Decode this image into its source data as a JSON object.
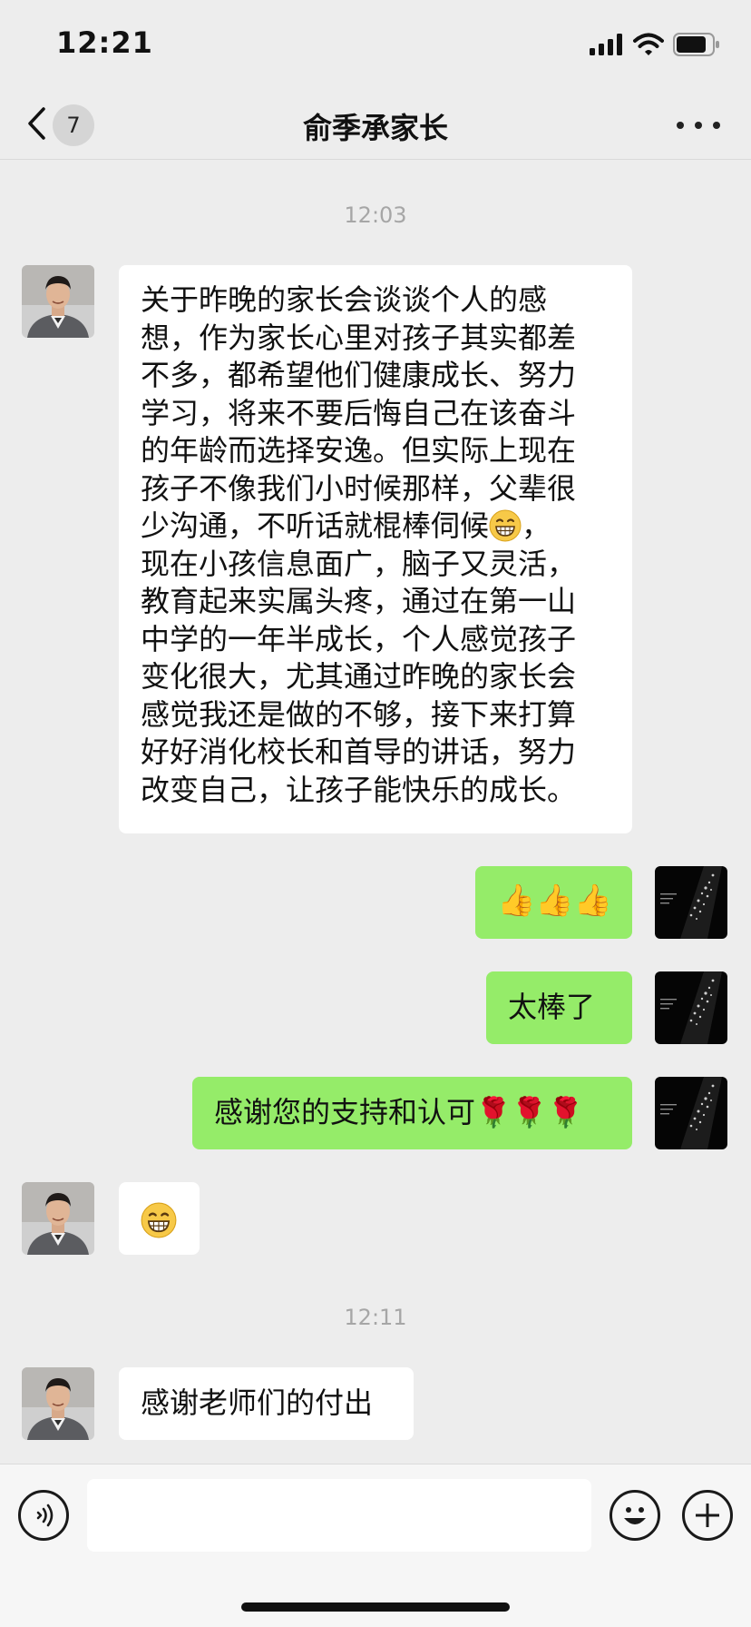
{
  "status_bar": {
    "time": "12:21",
    "icons": [
      "signal-icon",
      "wifi-icon",
      "battery-icon"
    ]
  },
  "nav": {
    "back_count": "7",
    "title": "俞季承家长",
    "icons": [
      "chevron-left-icon",
      "more-icon"
    ]
  },
  "messages": [
    {
      "type": "time",
      "text": "12:03"
    },
    {
      "type": "message",
      "side": "left",
      "sender": "parent",
      "lines": [
        "关于昨晚的家长会谈谈个人的感",
        "想，作为家长心里对孩子其实都差",
        "不多，都希望他们健康成长、努力",
        "学习，将来不要后悔自己在该奋斗",
        "的年龄而选择安逸。但实际上现在",
        "孩子不像我们小时候那样，父辈很",
        "少沟通，不听话就棍棒伺候",
        "，",
        "现在小孩信息面广，脑子又灵活，",
        "教育起来实属头疼，通过在第一山",
        "中学的一年半成长，个人感觉孩子",
        "变化很大，尤其通过昨晚的家长会",
        "感觉我还是做的不够，接下来打算",
        "好好消化校长和首导的讲话，努力",
        "改变自己，让孩子能快乐的成长。"
      ]
    },
    {
      "type": "message",
      "side": "right",
      "sender": "self",
      "text": "👍👍👍"
    },
    {
      "type": "message",
      "side": "right",
      "sender": "self",
      "text": "太棒了"
    },
    {
      "type": "message",
      "side": "right",
      "sender": "self",
      "text": "感谢您的支持和认可🌹🌹🌹"
    },
    {
      "type": "message",
      "side": "left",
      "sender": "parent",
      "emoji": "grinning-face-icon"
    },
    {
      "type": "time",
      "text": "12:11"
    },
    {
      "type": "message",
      "side": "left",
      "sender": "parent",
      "text": "感谢老师们的付出"
    }
  ],
  "input_bar": {
    "icons": [
      "voice-icon",
      "emoji-icon",
      "plus-icon"
    ],
    "input_value": ""
  },
  "colors": {
    "background": "#ededed",
    "bubble_self": "#95ec69",
    "bubble_other": "#ffffff",
    "timestamp": "#a6a6a6"
  }
}
